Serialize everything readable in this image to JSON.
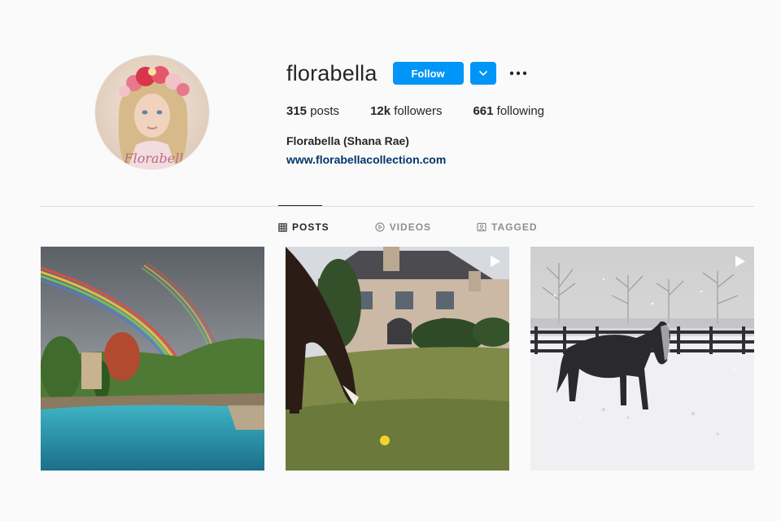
{
  "profile": {
    "username": "florabella",
    "full_name": "Florabella (Shana Rae)",
    "website": "www.florabellacollection.com",
    "avatar_signature": "Florabell"
  },
  "actions": {
    "follow_label": "Follow",
    "dropdown_icon": "chevron-down-icon",
    "options_icon": "more-options-icon"
  },
  "stats": {
    "posts_count": "315",
    "posts_label": "posts",
    "followers_count": "12k",
    "followers_label": "followers",
    "following_count": "661",
    "following_label": "following"
  },
  "tabs": [
    {
      "label": "POSTS",
      "icon": "grid-icon",
      "active": true
    },
    {
      "label": "VIDEOS",
      "icon": "play-circle-icon",
      "active": false
    },
    {
      "label": "TAGGED",
      "icon": "tagged-icon",
      "active": false
    }
  ],
  "posts": [
    {
      "subject": "rainbow-pool",
      "is_video": false
    },
    {
      "subject": "horse-grazing-mansion",
      "is_video": true
    },
    {
      "subject": "horse-snow",
      "is_video": true
    }
  ],
  "colors": {
    "accent": "#0095f6",
    "link": "#00376b",
    "background": "#fafafa",
    "muted": "#8e8e8e"
  }
}
